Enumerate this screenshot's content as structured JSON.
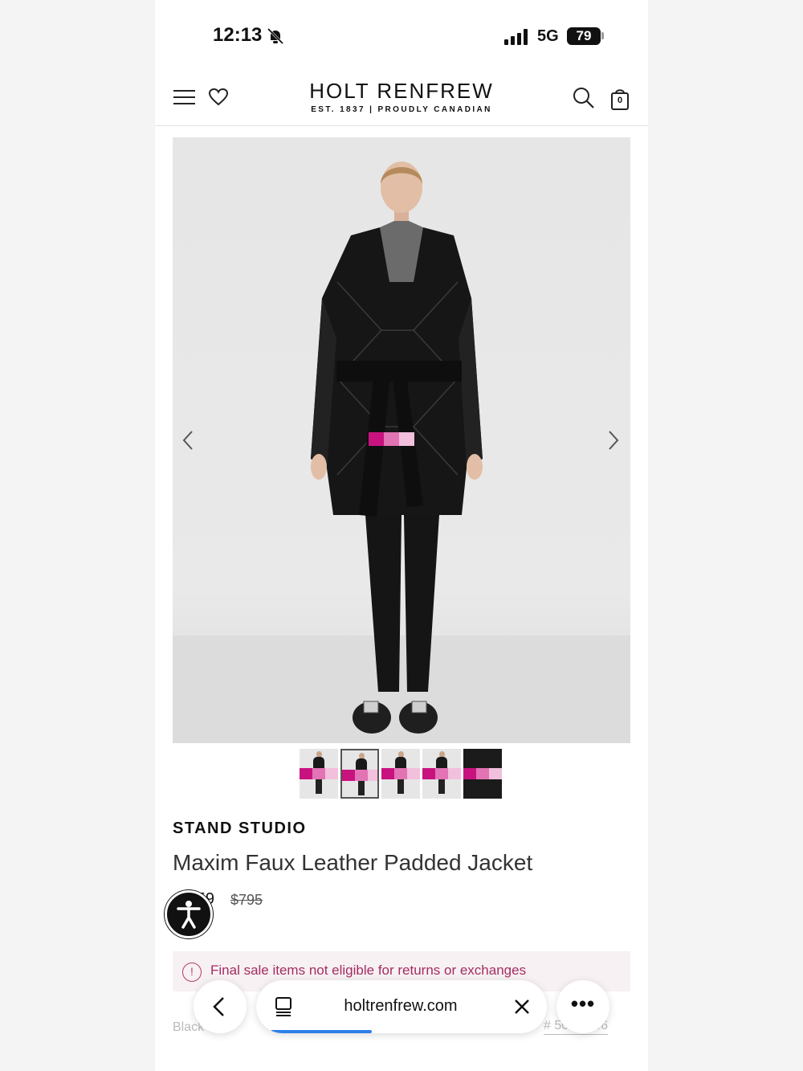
{
  "status_bar": {
    "time": "12:13",
    "network": "5G",
    "battery": "79"
  },
  "header": {
    "logo_name": "HOLT RENFREW",
    "logo_tagline": "EST. 1837 | PROUDLY CANADIAN",
    "bag_count": "0"
  },
  "gallery": {
    "thumbnail_count": 5,
    "active_thumbnail": 2,
    "redaction_colors": [
      "#c8137f",
      "#e273b4",
      "#f2bfdc"
    ]
  },
  "product": {
    "brand": "STAND STUDIO",
    "name": "Maxim Faux Leather Padded Jacket",
    "sale_price": "$...59",
    "original_price": "$795",
    "notice": "Final sale items not eligible for returns or exchanges",
    "color_label": "Black",
    "sku": "# 50...3746"
  },
  "browser": {
    "url": "holtrenfrew.com",
    "more_label": "•••",
    "load_progress": 0.35
  },
  "colors": {
    "notice_text": "#a52c62",
    "progress": "#2f7fe8"
  }
}
